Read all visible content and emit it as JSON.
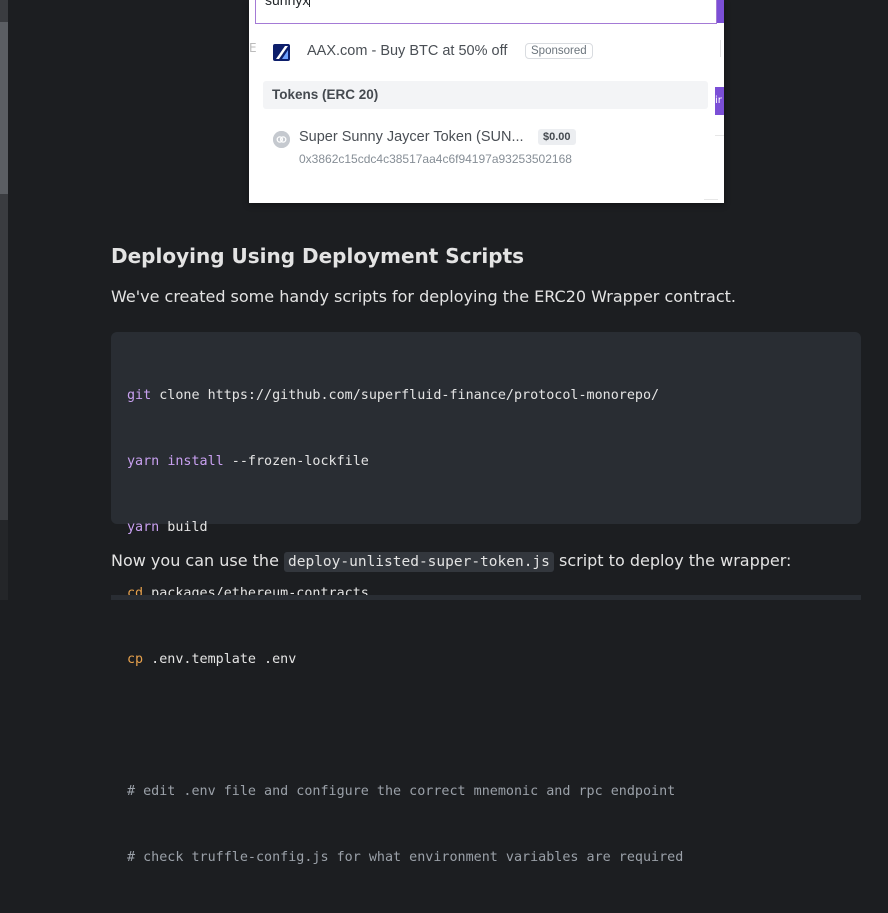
{
  "search": {
    "query": "sunnyx",
    "background_fragment": "E",
    "button_fragment": "ir",
    "ad": {
      "logo_icon": "aax-logo-icon",
      "text": "AAX.com - Buy BTC at 50% off",
      "badge": "Sponsored"
    },
    "tokens_header": "Tokens (ERC 20)",
    "token": {
      "icon": "token-link-icon",
      "name": "Super Sunny Jaycer Token (SUN...",
      "price": "$0.00",
      "address": "0x3862c15cdc4c38517aa4c6f94197a93253502168"
    }
  },
  "doc": {
    "heading": "Deploying Using Deployment Scripts",
    "paragraph": "We've created some handy scripts for deploying the ERC20 Wrapper contract.",
    "code": [
      {
        "cmd": "git",
        "rest": " clone https://github.com/superfluid-finance/protocol-monorepo/"
      },
      {
        "cmd": "yarn",
        "mid": " ",
        "arg": "install",
        "rest": " --frozen-lockfile"
      },
      {
        "cmd": "yarn",
        "rest": " build"
      },
      {
        "cmd": "cd",
        "rest": " packages/ethereum-contracts"
      },
      {
        "cmd": "cp",
        "rest": " .env.template .env"
      },
      {
        "comment": "# edit .env file and configure the correct mnemonic and rpc endpoint"
      },
      {
        "comment": "# check truffle-config.js for what environment variables are required"
      }
    ],
    "para2": {
      "before": "Now you can use the ",
      "code": "deploy-unlisted-super-token.js",
      "after": " script to deploy the wrapper:"
    }
  },
  "colors": {
    "background": "#1c1e21",
    "code_bg": "#292d33",
    "keyword": "#c8a0f0",
    "command": "#e6a04c",
    "accent": "#7b4fd6"
  }
}
